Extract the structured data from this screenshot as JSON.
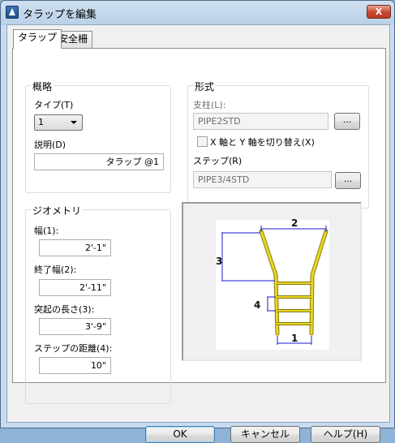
{
  "window": {
    "title": "タラップを編集",
    "close_label": "X"
  },
  "tabs": [
    {
      "label": "タラップ",
      "active": true
    },
    {
      "label": "安全柵",
      "active": false
    }
  ],
  "overview": {
    "group_label": "概略",
    "type_label": "タイプ(T)",
    "type_value": "1",
    "description_label": "説明(D)",
    "description_value": "タラップ @1"
  },
  "form": {
    "group_label": "形式",
    "post_label": "支柱(L):",
    "post_value": "PIPE2STD",
    "post_browse_label": "...",
    "swap_axes_label": "X 軸と Y 軸を切り替え(X)",
    "swap_axes_checked": false,
    "step_label": "ステップ(R)",
    "step_value": "PIPE3/4STD",
    "step_browse_label": "..."
  },
  "geometry": {
    "group_label": "ジオメトリ",
    "width_label": "幅(1):",
    "width_value": "2'-1\"",
    "end_width_label": "終了幅(2):",
    "end_width_value": "2'-11\"",
    "protrusion_label": "突起の長さ(3):",
    "protrusion_value": "3'-9\"",
    "step_distance_label": "ステップの距離(4):",
    "step_distance_value": "10\""
  },
  "preview": {
    "dim_1": "1",
    "dim_2": "2",
    "dim_3": "3",
    "dim_4": "4"
  },
  "buttons": {
    "ok": "OK",
    "cancel": "キャンセル",
    "help": "ヘルプ(H)"
  },
  "colors": {
    "ladder": "#e8d820",
    "dimension": "#1a1ad0"
  }
}
